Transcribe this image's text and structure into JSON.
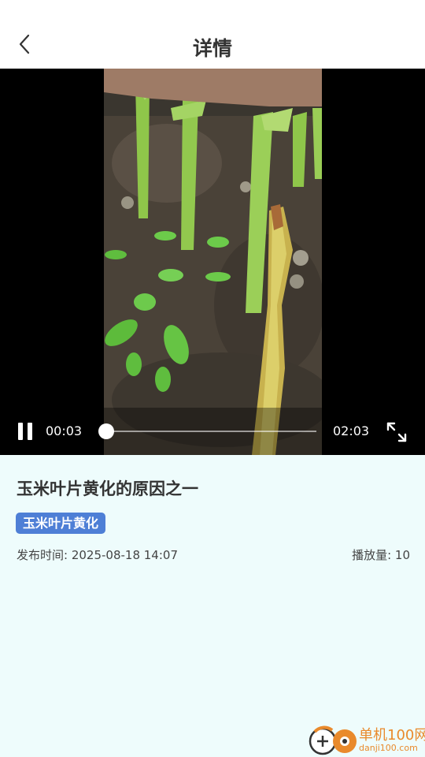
{
  "header": {
    "title": "详情",
    "back_icon": "chevron-left-icon"
  },
  "video": {
    "current_time": "00:03",
    "total_time": "02:03",
    "progress": 0.025,
    "state": "playing",
    "pause_icon": "pause-icon",
    "fullscreen_icon": "fullscreen-expand-icon"
  },
  "post": {
    "title": "玉米叶片黄化的原因之一",
    "tag": "玉米叶片黄化",
    "publish_time": "发布时间: 2025-08-18 14:07",
    "play_count": "播放量: 10"
  },
  "watermark": {
    "name": "单机100网",
    "url": "danji100.com"
  },
  "colors": {
    "page_bg": "#eefcfc",
    "tag_bg": "#4e7fd6",
    "watermark": "#e98a2c"
  }
}
